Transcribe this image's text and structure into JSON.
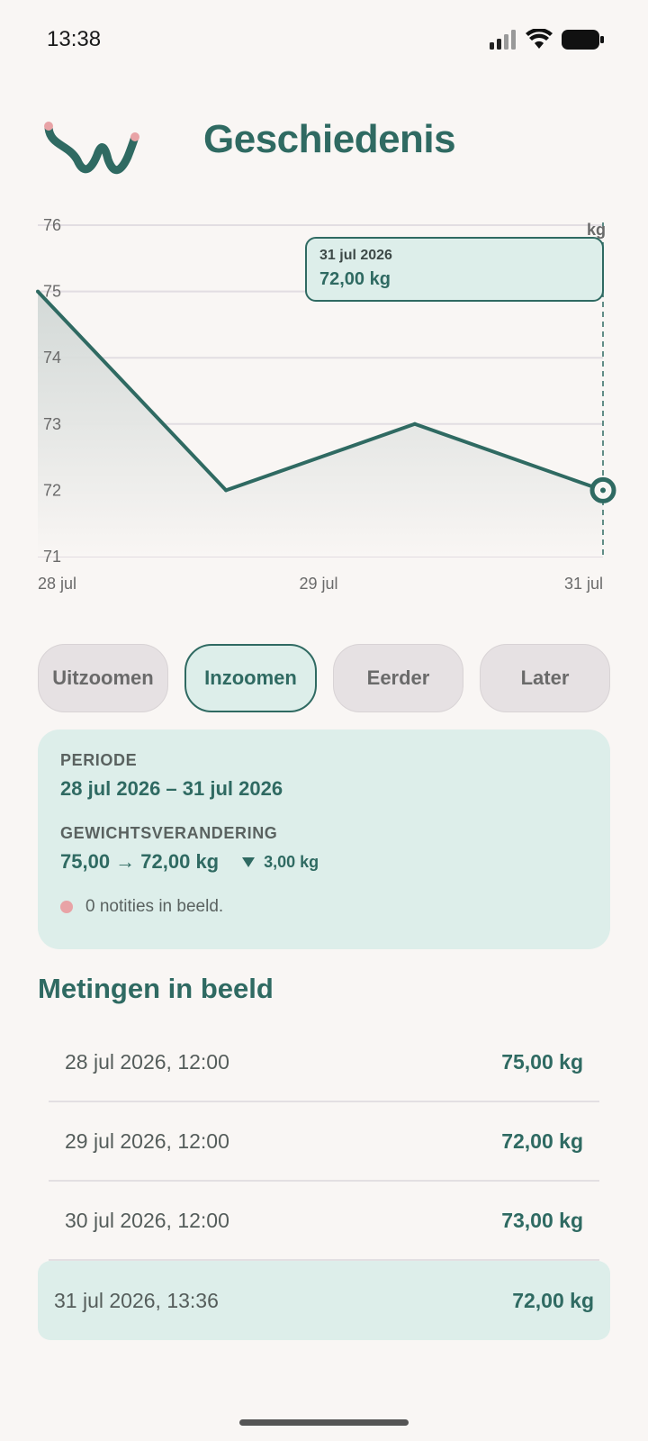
{
  "status": {
    "time": "13:38"
  },
  "header": {
    "title": "Geschiedenis"
  },
  "chart_data": {
    "type": "line",
    "x": [
      "28 jul 12:00",
      "29 jul 12:00",
      "30 jul 12:00",
      "31 jul 13:36"
    ],
    "values": [
      75,
      72,
      73,
      72
    ],
    "y_ticks": [
      "76",
      "75",
      "74",
      "73",
      "72",
      "71"
    ],
    "x_ticks": [
      "28 jul",
      "29 jul",
      "31 jul"
    ],
    "unit": "kg",
    "ylim": [
      71,
      76
    ],
    "grid": true,
    "line_color": "#2f6a62",
    "selected_point_index": 3
  },
  "tooltip": {
    "date": "31 jul 2026",
    "value": "72,00 kg"
  },
  "controls": {
    "zoom_out": "Uitzoomen",
    "zoom_in": "Inzoomen",
    "earlier": "Eerder",
    "later": "Later"
  },
  "summary": {
    "period_label": "PERIODE",
    "period_value": "28 jul 2026 – 31 jul 2026",
    "change_label": "GEWICHTSVERANDERING",
    "change_value": "75,00 → 72,00 kg",
    "change_delta": "3,00 kg",
    "notes": "0 notities in beeld."
  },
  "measurements": {
    "title": "Metingen in beeld",
    "items": [
      {
        "date": "28 jul 2026, 12:00",
        "value": "75,00 kg"
      },
      {
        "date": "29 jul 2026, 12:00",
        "value": "72,00 kg"
      },
      {
        "date": "30 jul 2026, 12:00",
        "value": "73,00 kg"
      },
      {
        "date": "31 jul 2026, 13:36",
        "value": "72,00 kg"
      }
    ]
  },
  "colors": {
    "accent": "#2f6a62",
    "accent_light": "#ddeeea",
    "note_dot": "#e8a3a6",
    "background": "#f9f6f4"
  }
}
